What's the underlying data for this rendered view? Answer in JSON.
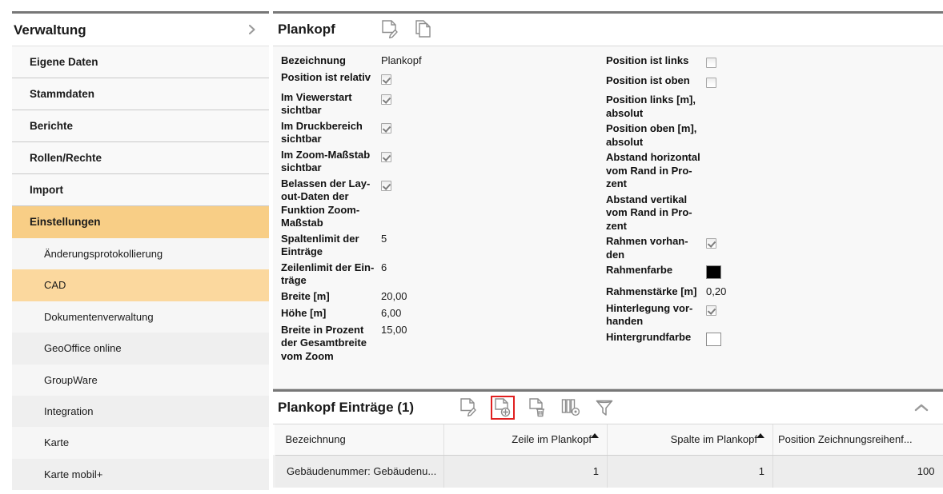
{
  "sidebar": {
    "title": "Verwaltung",
    "expand_icon": "chevron-right-icon",
    "items": [
      {
        "label": "Eigene Daten",
        "level": 1,
        "active": false
      },
      {
        "label": "Stammdaten",
        "level": 1,
        "active": false
      },
      {
        "label": "Berichte",
        "level": 1,
        "active": false
      },
      {
        "label": "Rollen/Rechte",
        "level": 1,
        "active": false
      },
      {
        "label": "Import",
        "level": 1,
        "active": false
      },
      {
        "label": "Einstellungen",
        "level": 1,
        "active": true
      },
      {
        "label": "Änderungsprotokollierung",
        "level": 2,
        "active": false
      },
      {
        "label": "CAD",
        "level": 2,
        "active": true
      },
      {
        "label": "Dokumentenverwaltung",
        "level": 2,
        "active": false
      },
      {
        "label": "GeoOffice online",
        "level": 2,
        "active": false
      },
      {
        "label": "GroupWare",
        "level": 2,
        "active": false
      },
      {
        "label": "Integration",
        "level": 2,
        "active": false
      },
      {
        "label": "Karte",
        "level": 2,
        "active": false
      },
      {
        "label": "Karte mobil+",
        "level": 2,
        "active": false
      }
    ]
  },
  "detail_panel": {
    "title": "Plankopf",
    "toolbar": [
      {
        "name": "edit-icon",
        "label": "Bearbeiten",
        "highlighted": false
      },
      {
        "name": "copy-icon",
        "label": "Kopieren",
        "highlighted": false
      }
    ],
    "left_column": [
      {
        "label": "Bezeichnung",
        "type": "text",
        "value": "Plankopf",
        "bold": true
      },
      {
        "label": "Position ist relativ",
        "type": "checkbox",
        "checked": true,
        "bold": true
      },
      {
        "label": "Im Viewerstart sichtbar",
        "type": "checkbox",
        "checked": true,
        "bold": true
      },
      {
        "label": "Im Druckbereich sichtbar",
        "type": "checkbox",
        "checked": true,
        "bold": true
      },
      {
        "label": "Im Zoom-Maßstab sichtbar",
        "type": "checkbox",
        "checked": true,
        "bold": true
      },
      {
        "label": "Belassen der Lay-out-Daten der Funktion Zoom-Maßstab",
        "type": "checkbox",
        "checked": true,
        "bold": true
      },
      {
        "label": "Spaltenlimit der Einträge",
        "type": "text",
        "value": "5",
        "bold": true
      },
      {
        "label": "Zeilenlimit der Ein-träge",
        "type": "text",
        "value": "6",
        "bold": true
      },
      {
        "label": "Breite [m]",
        "type": "text",
        "value": "20,00",
        "bold": true
      },
      {
        "label": "Höhe [m]",
        "type": "text",
        "value": "6,00",
        "bold": true
      },
      {
        "label": "Breite in Prozent der Gesamtbreite vom Zoom",
        "type": "text",
        "value": "15,00",
        "bold": true
      }
    ],
    "right_column": [
      {
        "label": "Position ist links",
        "type": "checkbox",
        "checked": false,
        "bold": true
      },
      {
        "label": "Position ist oben",
        "type": "checkbox",
        "checked": false,
        "bold": true
      },
      {
        "label": "Position links [m], absolut",
        "type": "text",
        "value": "",
        "bold": true
      },
      {
        "label": "Position oben [m], absolut",
        "type": "text",
        "value": "",
        "bold": true
      },
      {
        "label": "Abstand horizontal vom Rand in Pro-zent",
        "type": "text",
        "value": "",
        "bold": true
      },
      {
        "label": "Abstand vertikal vom Rand in Pro-zent",
        "type": "text",
        "value": "",
        "bold": true
      },
      {
        "label": "Rahmen vorhan-den",
        "type": "checkbox",
        "checked": true,
        "bold": true
      },
      {
        "label": "Rahmenfarbe",
        "type": "color",
        "color": "#000000",
        "bold": true
      },
      {
        "label": "Rahmenstärke [m]",
        "type": "text",
        "value": "0,20",
        "bold": true
      },
      {
        "label": "Hinterlegung vor-handen",
        "type": "checkbox",
        "checked": true,
        "bold": true
      },
      {
        "label": "Hintergrundfarbe",
        "type": "color",
        "color": "#ffffff",
        "bold": true
      }
    ]
  },
  "entries_panel": {
    "title": "Plankopf Einträge (1)",
    "collapse_icon": "chevron-up-icon",
    "toolbar": [
      {
        "name": "edit-icon",
        "label": "Bearbeiten",
        "highlighted": false
      },
      {
        "name": "add-document-icon",
        "label": "Neu",
        "highlighted": true
      },
      {
        "name": "delete-icon",
        "label": "Löschen",
        "highlighted": false
      },
      {
        "name": "columns-config-icon",
        "label": "Spalten",
        "highlighted": false
      },
      {
        "name": "filter-icon",
        "label": "Filter",
        "highlighted": false
      }
    ],
    "table": {
      "columns": [
        {
          "label": "Bezeichnung",
          "align": "left",
          "sorted": false
        },
        {
          "label": "Zeile im Plankopf",
          "align": "right",
          "sorted": true
        },
        {
          "label": "Spalte im Plankopf",
          "align": "right",
          "sorted": true
        },
        {
          "label": "Position Zeichnungsreihenf...",
          "align": "left",
          "sorted": false
        }
      ],
      "rows": [
        {
          "bezeichnung": "Gebäudenummer: Gebäudenu...",
          "zeile": "1",
          "spalte": "1",
          "position": "100"
        }
      ]
    }
  }
}
